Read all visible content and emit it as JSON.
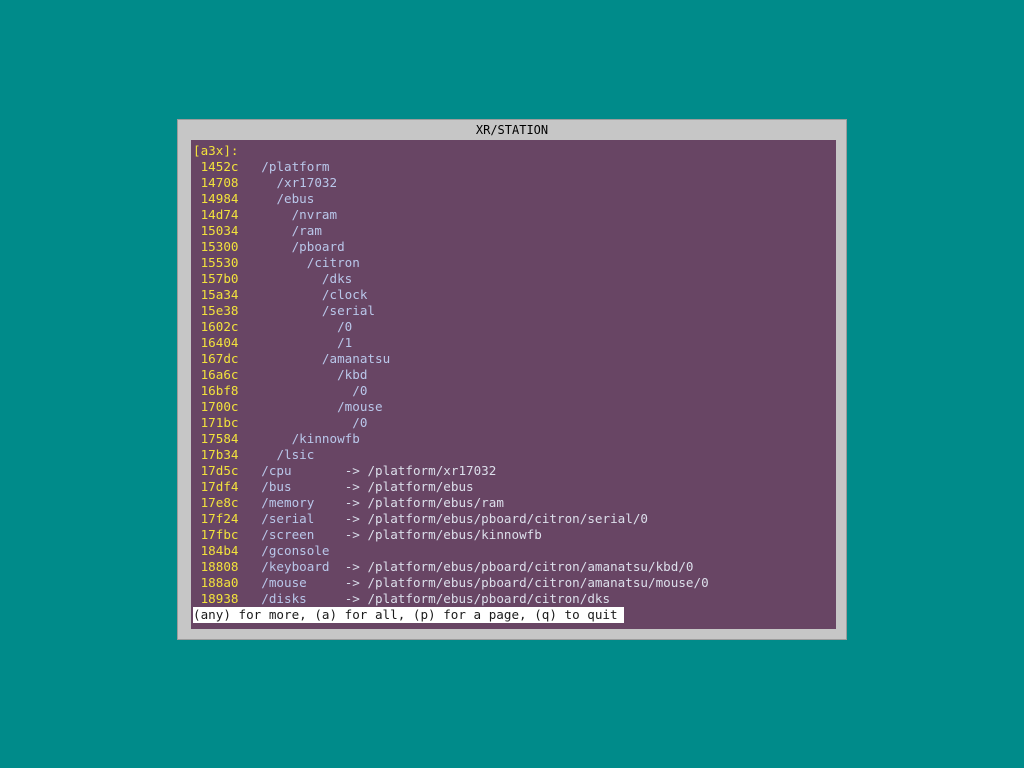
{
  "window": {
    "title": "XR/STATION"
  },
  "terminal": {
    "prompt": "[a3x]:",
    "tree": [
      {
        "addr": "1452c",
        "indent": 0,
        "name": "/platform"
      },
      {
        "addr": "14708",
        "indent": 1,
        "name": "/xr17032"
      },
      {
        "addr": "14984",
        "indent": 1,
        "name": "/ebus"
      },
      {
        "addr": "14d74",
        "indent": 2,
        "name": "/nvram"
      },
      {
        "addr": "15034",
        "indent": 2,
        "name": "/ram"
      },
      {
        "addr": "15300",
        "indent": 2,
        "name": "/pboard"
      },
      {
        "addr": "15530",
        "indent": 3,
        "name": "/citron"
      },
      {
        "addr": "157b0",
        "indent": 4,
        "name": "/dks"
      },
      {
        "addr": "15a34",
        "indent": 4,
        "name": "/clock"
      },
      {
        "addr": "15e38",
        "indent": 4,
        "name": "/serial"
      },
      {
        "addr": "1602c",
        "indent": 5,
        "name": "/0"
      },
      {
        "addr": "16404",
        "indent": 5,
        "name": "/1"
      },
      {
        "addr": "167dc",
        "indent": 4,
        "name": "/amanatsu"
      },
      {
        "addr": "16a6c",
        "indent": 5,
        "name": "/kbd"
      },
      {
        "addr": "16bf8",
        "indent": 6,
        "name": "/0"
      },
      {
        "addr": "1700c",
        "indent": 5,
        "name": "/mouse"
      },
      {
        "addr": "171bc",
        "indent": 6,
        "name": "/0"
      },
      {
        "addr": "17584",
        "indent": 2,
        "name": "/kinnowfb"
      },
      {
        "addr": "17b34",
        "indent": 1,
        "name": "/lsic"
      }
    ],
    "aliases": [
      {
        "addr": "17d5c",
        "name": "/cpu",
        "target": "/platform/xr17032"
      },
      {
        "addr": "17df4",
        "name": "/bus",
        "target": "/platform/ebus"
      },
      {
        "addr": "17e8c",
        "name": "/memory",
        "target": "/platform/ebus/ram"
      },
      {
        "addr": "17f24",
        "name": "/serial",
        "target": "/platform/ebus/pboard/citron/serial/0"
      },
      {
        "addr": "17fbc",
        "name": "/screen",
        "target": "/platform/ebus/kinnowfb"
      },
      {
        "addr": "184b4",
        "name": "/gconsole",
        "target": ""
      },
      {
        "addr": "18808",
        "name": "/keyboard",
        "target": "/platform/ebus/pboard/citron/amanatsu/kbd/0"
      },
      {
        "addr": "188a0",
        "name": "/mouse",
        "target": "/platform/ebus/pboard/citron/amanatsu/mouse/0"
      },
      {
        "addr": "18938",
        "name": "/disks",
        "target": "/platform/ebus/pboard/citron/dks"
      }
    ],
    "arrow": "->",
    "pager_prompt": "(any) for more, (a) for all, (p) for a page, (q) to quit"
  },
  "colors": {
    "desktop": "#008b8a",
    "window_frame": "#c6c6c6",
    "terminal_bg": "#684564",
    "address": "#f2e23c",
    "path": "#b9c7ea",
    "pager_bg": "#ffffff"
  }
}
